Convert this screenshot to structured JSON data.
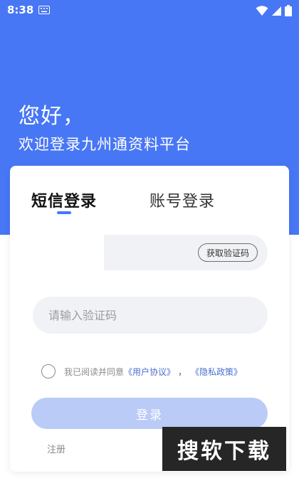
{
  "status_bar": {
    "time": "8:38"
  },
  "header": {
    "greeting": "您好，",
    "subtitle": "欢迎登录九州通资料平台"
  },
  "tabs": [
    {
      "label": "短信登录",
      "active": true
    },
    {
      "label": "账号登录",
      "active": false
    }
  ],
  "form": {
    "phone_value": "",
    "get_code_label": "获取验证码",
    "code_placeholder": "请输入验证码",
    "agreement_prefix": "我已阅读并同意",
    "user_agreement_link": "《用户协议》",
    "separator": "，",
    "privacy_link": "《隐私政策》",
    "agreement_checked": false,
    "login_label": "登录",
    "register_label": "注册"
  },
  "watermark": {
    "text": "搜软下载"
  },
  "colors": {
    "primary": "#4877f5",
    "login_disabled": "#b9cbf6",
    "link": "#4a6fd1",
    "input_bg": "#f1f2f5"
  },
  "icons": [
    "keyboard-icon",
    "wifi-icon",
    "signal-icon",
    "battery-icon"
  ]
}
